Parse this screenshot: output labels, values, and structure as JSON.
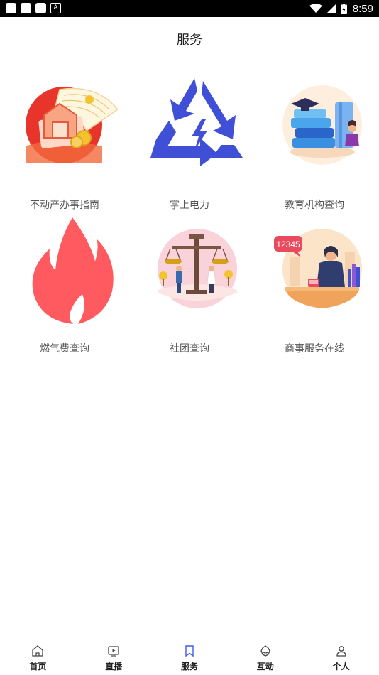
{
  "status_bar": {
    "time": "8:59"
  },
  "header": {
    "title": "服务"
  },
  "services": [
    {
      "label": "不动产办事指南",
      "icon": "real-estate-icon"
    },
    {
      "label": "掌上电力",
      "icon": "electric-power-icon"
    },
    {
      "label": "教育机构查询",
      "icon": "education-books-icon"
    },
    {
      "label": "燃气费查询",
      "icon": "gas-flame-icon"
    },
    {
      "label": "社团查询",
      "icon": "justice-scale-icon"
    },
    {
      "label": "商事服务在线",
      "icon": "customer-service-icon",
      "badge": "12345"
    }
  ],
  "bottom_nav": [
    {
      "label": "首页",
      "icon": "home-icon"
    },
    {
      "label": "直播",
      "icon": "live-icon"
    },
    {
      "label": "服务",
      "icon": "bookmark-icon",
      "active": true
    },
    {
      "label": "互动",
      "icon": "interact-icon"
    },
    {
      "label": "个人",
      "icon": "person-icon"
    }
  ],
  "colors": {
    "accent": "#3b5de7",
    "flame": "#ff5a5f",
    "power": "#3f4fd6"
  }
}
